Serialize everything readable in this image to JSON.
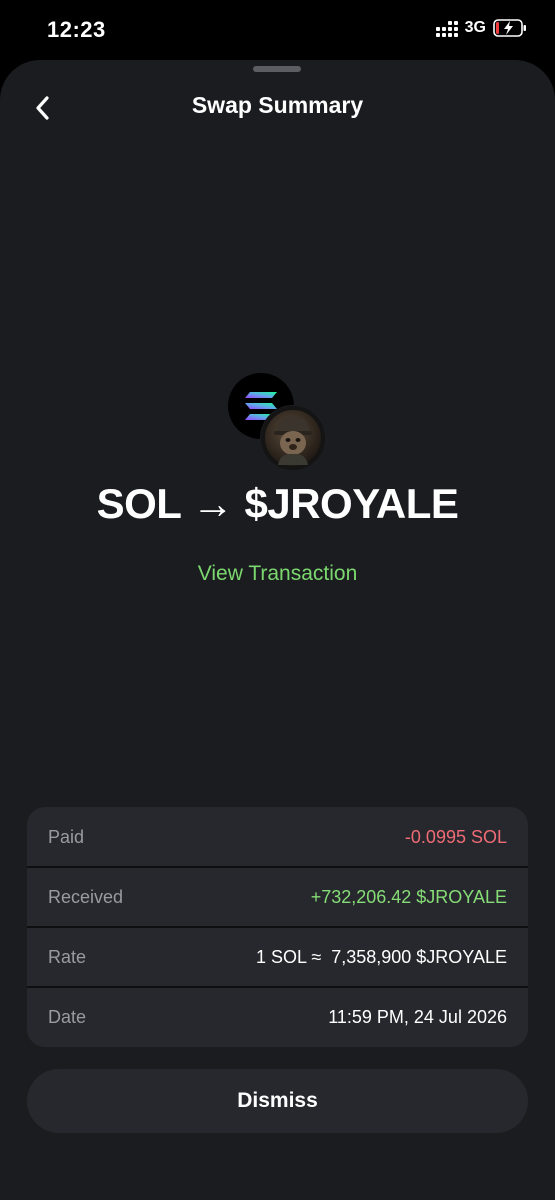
{
  "status_bar": {
    "time": "12:23",
    "network": "3G",
    "icons": [
      "signal-icon",
      "battery-charging-icon"
    ]
  },
  "header": {
    "title": "Swap Summary",
    "back_icon": "chevron-left-icon"
  },
  "swap": {
    "heading": "SOL → $JROYALE",
    "from_token_icon": "solana-logo-icon",
    "to_token_icon": "jroyale-token-icon",
    "view_transaction_label": "View Transaction"
  },
  "details": [
    {
      "label": "Paid",
      "value": "-0.0995 SOL",
      "tone": "negative"
    },
    {
      "label": "Received",
      "value": "+732,206.42 $JROYALE",
      "tone": "positive"
    },
    {
      "label": "Rate",
      "value": "1 SOL ≈  7,358,900 $JROYALE",
      "tone": "neutral"
    },
    {
      "label": "Date",
      "value": "11:59 PM, 24 Jul 2026",
      "tone": "neutral"
    }
  ],
  "dismiss_label": "Dismiss",
  "colors": {
    "background": "#1b1c20",
    "card": "#27282d",
    "accent_green": "#7bd86e",
    "negative_red": "#ef6b75",
    "positive_green": "#86dc76",
    "label_gray": "#9a9ba1"
  }
}
